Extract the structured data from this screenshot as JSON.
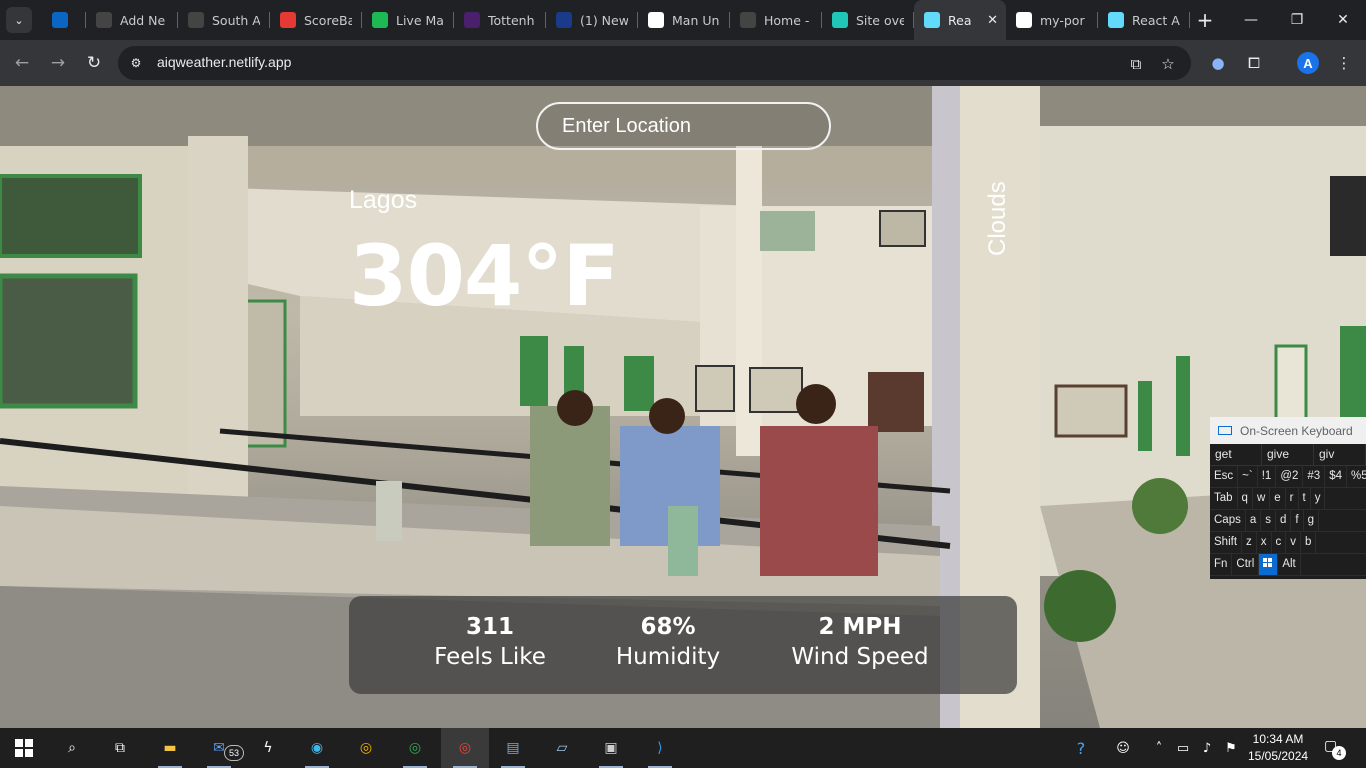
{
  "browser": {
    "tabs": [
      {
        "label": "",
        "icon": "linkedin-icon",
        "color": "#0a66c2"
      },
      {
        "label": "Add Ne",
        "icon": "site-icon",
        "color": "#444444"
      },
      {
        "label": "South A",
        "icon": "site-icon",
        "color": "#444444"
      },
      {
        "label": "ScoreBa",
        "icon": "scorebat-icon",
        "color": "#e53935"
      },
      {
        "label": "Live Ma",
        "icon": "live-icon",
        "color": "#1db954"
      },
      {
        "label": "Tottenh",
        "icon": "tottenham-icon",
        "color": "#4a1f6b"
      },
      {
        "label": "(1) New",
        "icon": "live-badge-icon",
        "color": "#1a3a8a"
      },
      {
        "label": "Man Un",
        "icon": "google-icon",
        "color": "#ffffff"
      },
      {
        "label": "Home -",
        "icon": "site-icon",
        "color": "#444444"
      },
      {
        "label": "Site ove",
        "icon": "netlify-icon",
        "color": "#20c6b7"
      },
      {
        "label": "Rea",
        "icon": "react-icon",
        "color": "#61dafb",
        "active": true
      },
      {
        "label": "my-por",
        "icon": "github-icon",
        "color": "#ffffff"
      },
      {
        "label": "React A",
        "icon": "react-icon",
        "color": "#61dafb"
      }
    ],
    "url": "aiqweather.netlify.app"
  },
  "weather": {
    "search_placeholder": "Enter Location",
    "city": "Lagos",
    "temperature": "304°F",
    "description": "Clouds",
    "stats": [
      {
        "value": "311",
        "label": "Feels Like"
      },
      {
        "value": "68%",
        "label": "Humidity"
      },
      {
        "value": "2 MPH",
        "label": "Wind Speed"
      }
    ]
  },
  "keyboard": {
    "title": "On-Screen Keyboard",
    "suggestions": [
      "get",
      "give",
      "giv"
    ],
    "rows": [
      [
        "Esc",
        "~`",
        "!1",
        "@2",
        "#3",
        "$4",
        "%5"
      ],
      [
        "Tab",
        "q",
        "w",
        "e",
        "r",
        "t",
        "y"
      ],
      [
        "Caps",
        "a",
        "s",
        "d",
        "f",
        "g"
      ],
      [
        "Shift",
        "z",
        "x",
        "c",
        "v",
        "b"
      ],
      [
        "Fn",
        "Ctrl",
        "Win",
        "Alt"
      ]
    ]
  },
  "taskbar": {
    "mail_badge": "53",
    "time": "10:34 AM",
    "date": "15/05/2024",
    "notifications": "4"
  }
}
